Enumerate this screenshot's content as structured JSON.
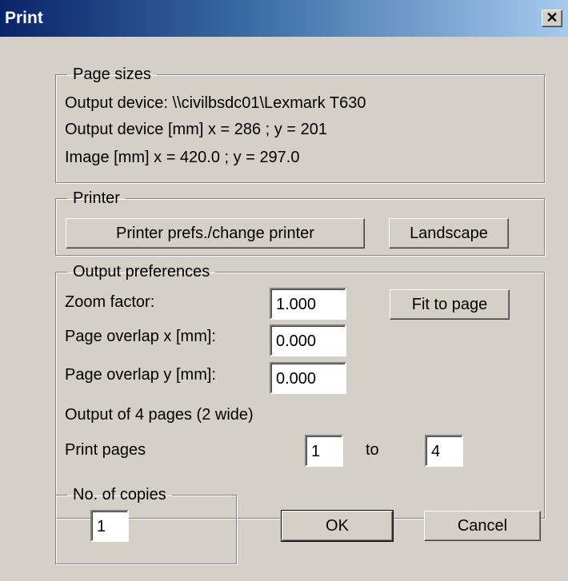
{
  "window": {
    "title": "Print",
    "close_glyph": "✕"
  },
  "page_sizes": {
    "legend": "Page sizes",
    "output_device": "Output device: \\\\civilbsdc01\\Lexmark T630",
    "output_device_mm": "Output device [mm]  x = 286 ; y = 201",
    "image_mm": "Image [mm]  x = 420.0 ; y = 297.0"
  },
  "printer": {
    "legend": "Printer",
    "prefs_button": "Printer prefs./change printer",
    "orientation_button": "Landscape"
  },
  "output_preferences": {
    "legend": "Output preferences",
    "zoom_label": "Zoom factor:",
    "zoom_value": "1.000",
    "fit_button": "Fit to page",
    "overlap_x_label": "Page overlap x [mm]:",
    "overlap_x_value": "0.000",
    "overlap_y_label": "Page overlap y [mm]:",
    "overlap_y_value": "0.000",
    "output_info": "Output of 4 pages (2 wide)",
    "print_pages_label": "Print pages",
    "from_value": "1",
    "to_label": "to",
    "to_value": "4"
  },
  "copies": {
    "legend": "No. of copies",
    "value": "1"
  },
  "actions": {
    "ok": "OK",
    "cancel": "Cancel"
  }
}
